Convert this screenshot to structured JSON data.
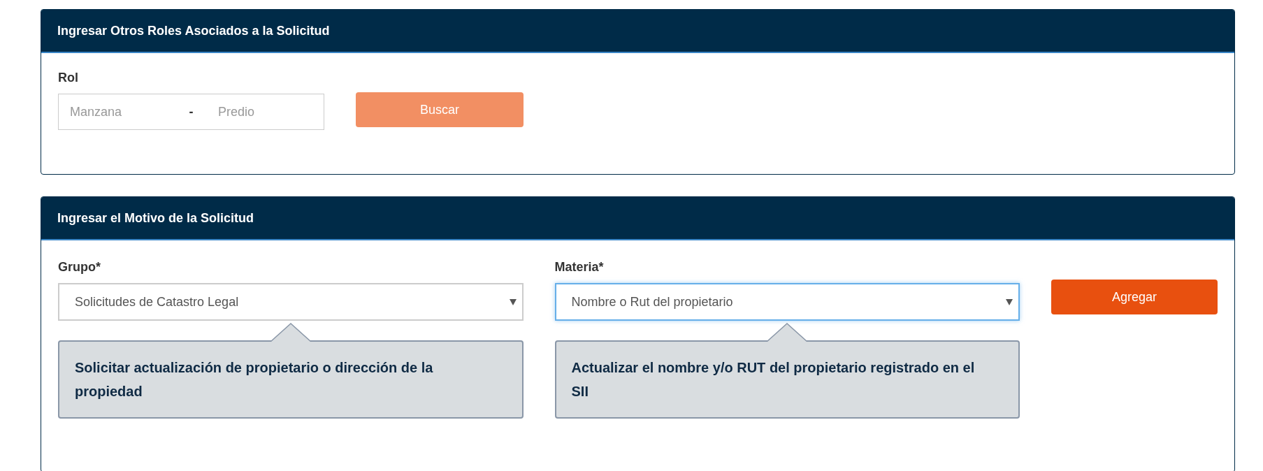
{
  "panels": [
    {
      "title": "Ingresar Otros Roles Asociados a la Solicitud",
      "kind": "rol",
      "label": "Rol",
      "fields": [
        {
          "placeholder": "Manzana"
        },
        {
          "placeholder": "Predio"
        }
      ],
      "separator": "-",
      "button": {
        "label": "Buscar",
        "disabled": true
      }
    },
    {
      "title": "Ingresar el Motivo de la Solicitud",
      "kind": "motivo",
      "selects": [
        {
          "label": "Grupo*",
          "value": "Solicitudes de Catastro Legal",
          "focused": false,
          "description": "Solicitar actualización de propietario o dirección de la propiedad"
        },
        {
          "label": "Materia*",
          "value": "Nombre o Rut del propietario",
          "focused": true,
          "description": "Actualizar el nombre y/o RUT del propietario registrado en el SII"
        }
      ],
      "button": {
        "label": "Agregar",
        "disabled": false
      }
    }
  ]
}
